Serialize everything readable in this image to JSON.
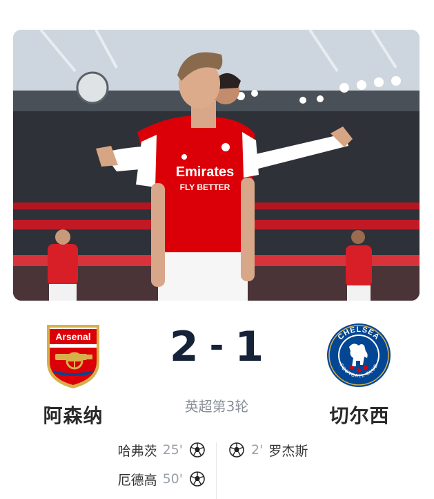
{
  "hero": {
    "photo_subject": "arsenal-celebration-photo",
    "sponsor_text": "Emirates",
    "sponsor_sub": "FLY BETTER"
  },
  "match": {
    "home": {
      "name": "阿森纳",
      "badge_text": "Arsenal",
      "color": "#db0007"
    },
    "away": {
      "name": "切尔西",
      "badge_text": "CHELSEA",
      "badge_sub": "FOOTBALL CLUB",
      "color": "#034694"
    },
    "score": {
      "home": "2",
      "separator": "-",
      "away": "1"
    },
    "round": "英超第3轮"
  },
  "scorers": {
    "home": [
      {
        "name": "哈弗茨",
        "minute": "25'",
        "icon": "football-icon"
      },
      {
        "name": "厄德高",
        "minute": "50'",
        "icon": "football-icon"
      }
    ],
    "away": [
      {
        "name": "罗杰斯",
        "minute": "2'",
        "icon": "football-icon"
      }
    ]
  }
}
